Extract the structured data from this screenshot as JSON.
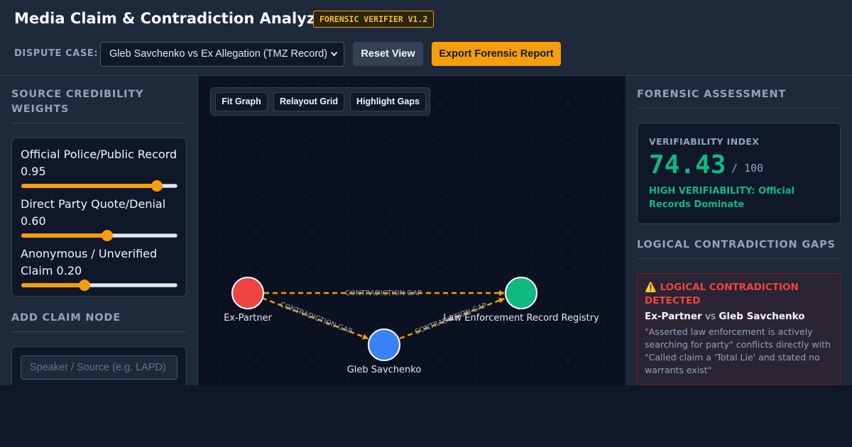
{
  "header": {
    "title": "Media Claim & Contradiction Analyzer",
    "version_badge": "FORENSIC VERIFIER V1.2",
    "case_label": "DISPUTE CASE:",
    "case_selected": "Gleb Savchenko vs Ex Allegation (TMZ Record)",
    "reset_label": "Reset View",
    "export_label": "Export Forensic Report"
  },
  "left_panel": {
    "weights_heading": "SOURCE CREDIBILITY WEIGHTS",
    "weights": [
      {
        "label": "Official Police/Public Record",
        "value": 0.95,
        "display": "0.95"
      },
      {
        "label": "Direct Party Quote/Denial",
        "value": 0.6,
        "display": "0.60"
      },
      {
        "label": "Anonymous / Unverified Claim",
        "value": 0.2,
        "display": "0.20"
      }
    ],
    "add_heading": "ADD CLAIM NODE",
    "speaker_placeholder": "Speaker / Source (e.g. LAPD)"
  },
  "graph": {
    "toolbar": {
      "fit": "Fit Graph",
      "relayout": "Relayout Grid",
      "highlight": "Highlight Gaps"
    },
    "nodes": [
      {
        "id": "ex",
        "label": "Ex-Partner",
        "color": "#ef4444"
      },
      {
        "id": "gleb",
        "label": "Gleb Savchenko",
        "color": "#3b82f6"
      },
      {
        "id": "le",
        "label": "Law Enforcement Record Registry",
        "color": "#10b981"
      }
    ],
    "edges": [
      {
        "from": "ex",
        "to": "le",
        "label": "CONTRADICTION GAP"
      },
      {
        "from": "ex",
        "to": "gleb",
        "label": "CONTRADICTION GAP"
      },
      {
        "from": "gleb",
        "to": "le",
        "label": "CONTRADICTION GAP"
      }
    ],
    "edge_color": "#f59e0b"
  },
  "right_panel": {
    "assessment_heading": "FORENSIC ASSESSMENT",
    "index_label": "VERIFIABILITY INDEX",
    "index_value": "74.43",
    "index_max": "/ 100",
    "index_status": "HIGH VERIFIABILITY: Official Records Dominate",
    "gaps_heading": "LOGICAL CONTRADICTION GAPS",
    "gap": {
      "title": "LOGICAL CONTRADICTION DETECTED",
      "party_a": "Ex-Partner",
      "vs": "vs",
      "party_b": "Gleb Savchenko",
      "detail": "\"Asserted law enforcement is actively searching for party\" conflicts directly with \"Called claim a 'Total Lie' and stated no warrants exist\""
    }
  },
  "colors": {
    "accent": "#f59e0b",
    "success": "#10b981",
    "danger": "#ef4444",
    "info": "#3b82f6"
  }
}
